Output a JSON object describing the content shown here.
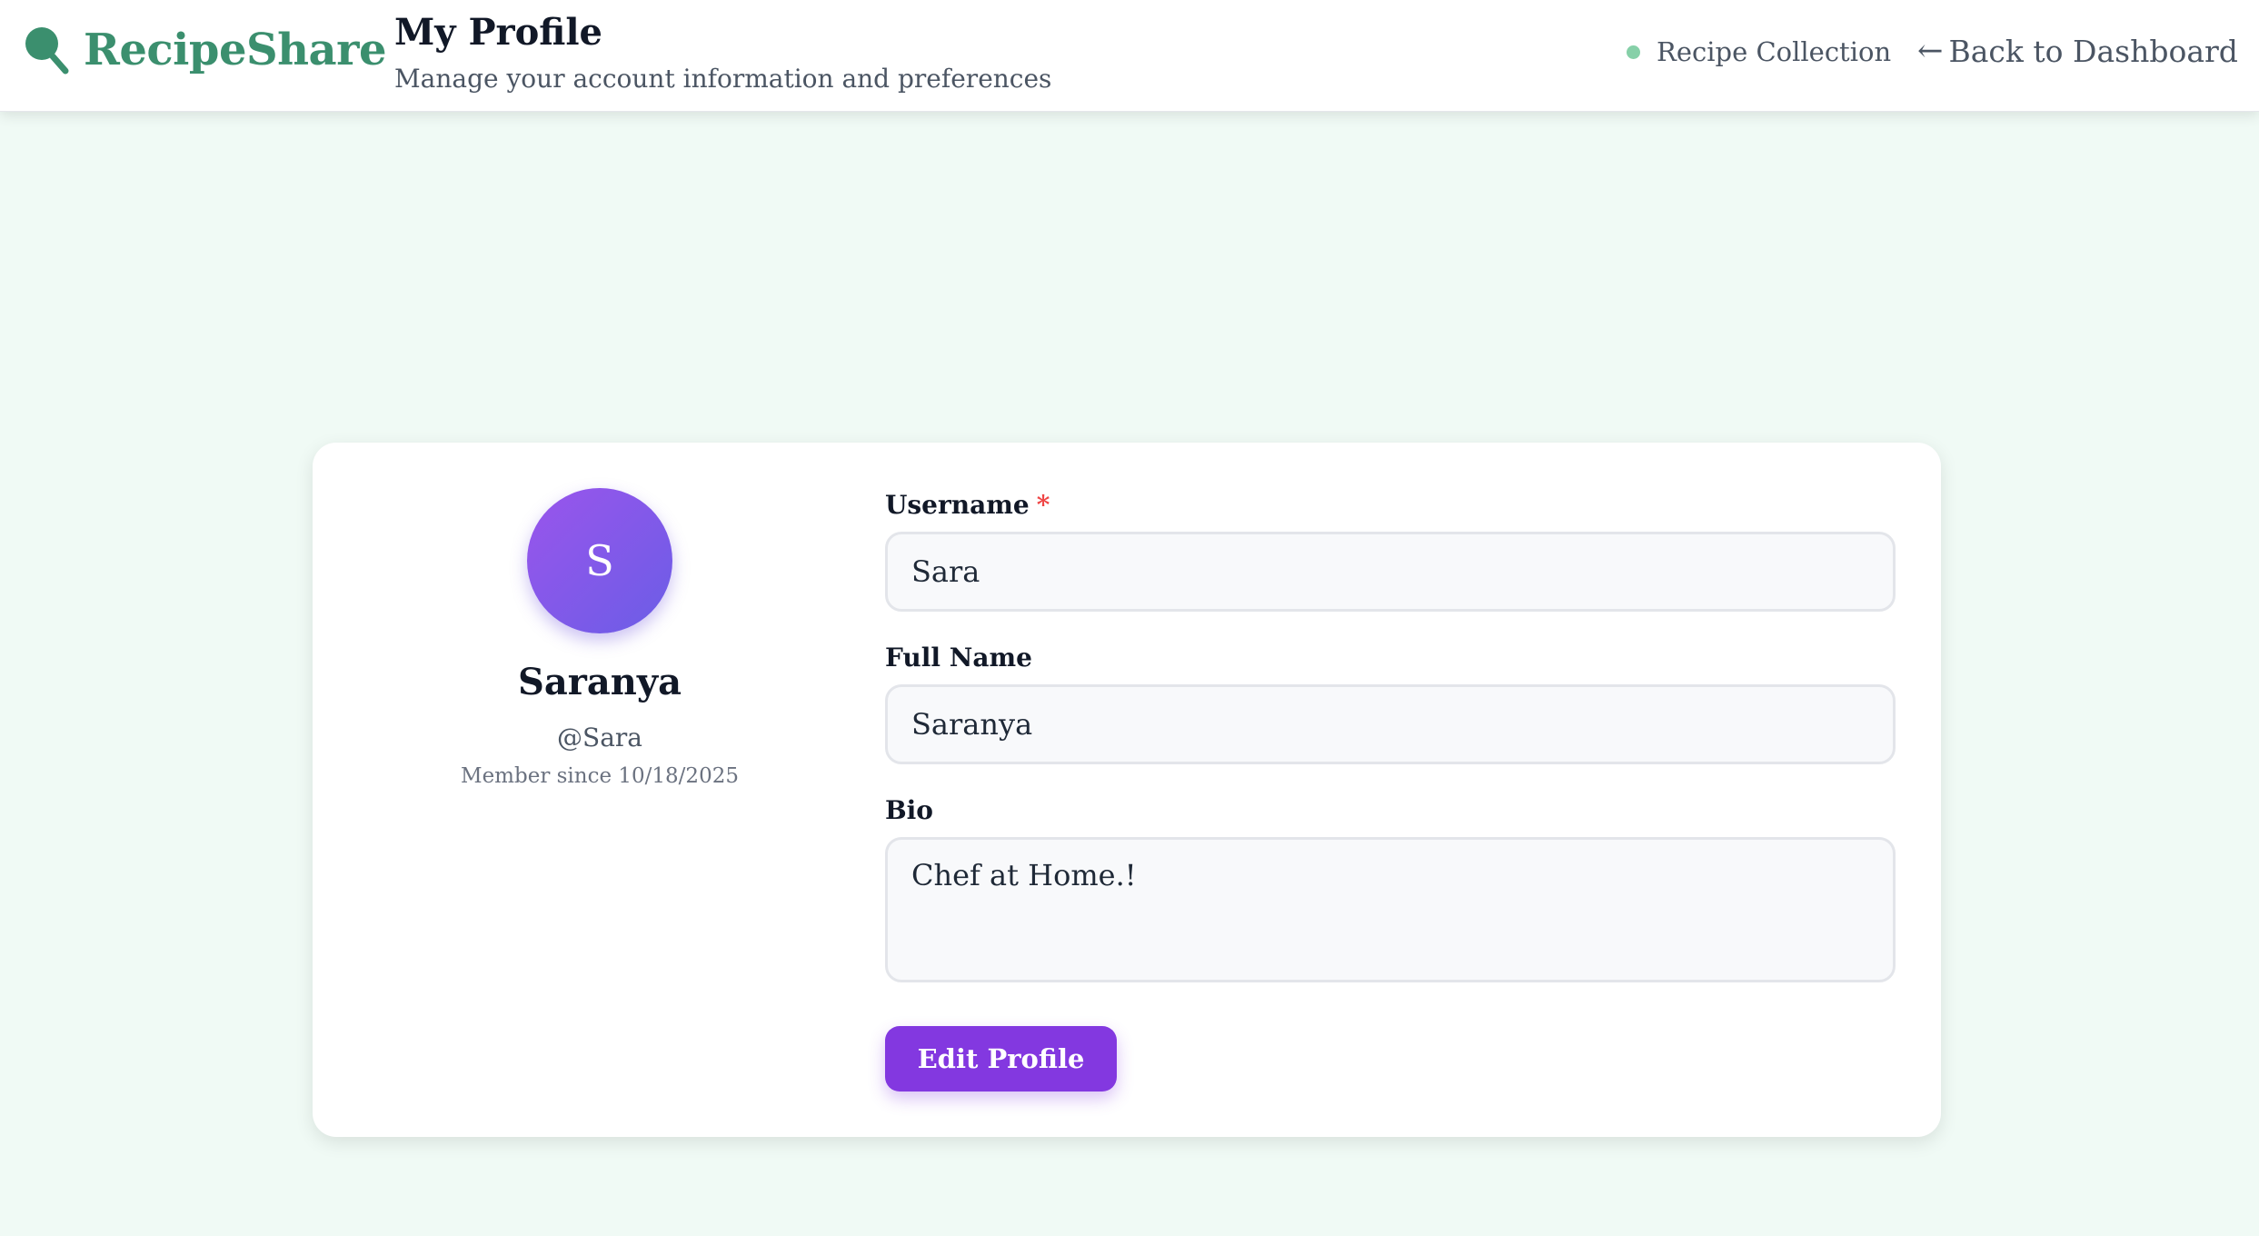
{
  "header": {
    "logo_icon": "magnifier-icon",
    "app_name": "RecipeShare",
    "title": "My Profile",
    "subtitle": "Manage your account information and preferences",
    "collection_link": "Recipe Collection",
    "back_arrow": "←",
    "back_link": "Back to Dashboard"
  },
  "profile": {
    "avatar_initial": "S",
    "display_name": "Saranya",
    "handle": "@Sara",
    "member_since": "Member since 10/18/2025"
  },
  "form": {
    "username_label": "Username",
    "required_marker": "*",
    "username_value": "Sara",
    "fullname_label": "Full Name",
    "fullname_value": "Saranya",
    "bio_label": "Bio",
    "bio_value": "Chef at Home.!",
    "edit_button": "Edit Profile"
  },
  "colors": {
    "brand": "#3b8f6e",
    "accent": "#8338e0",
    "background": "#f0faf5",
    "status_dot": "#86d0a8"
  }
}
